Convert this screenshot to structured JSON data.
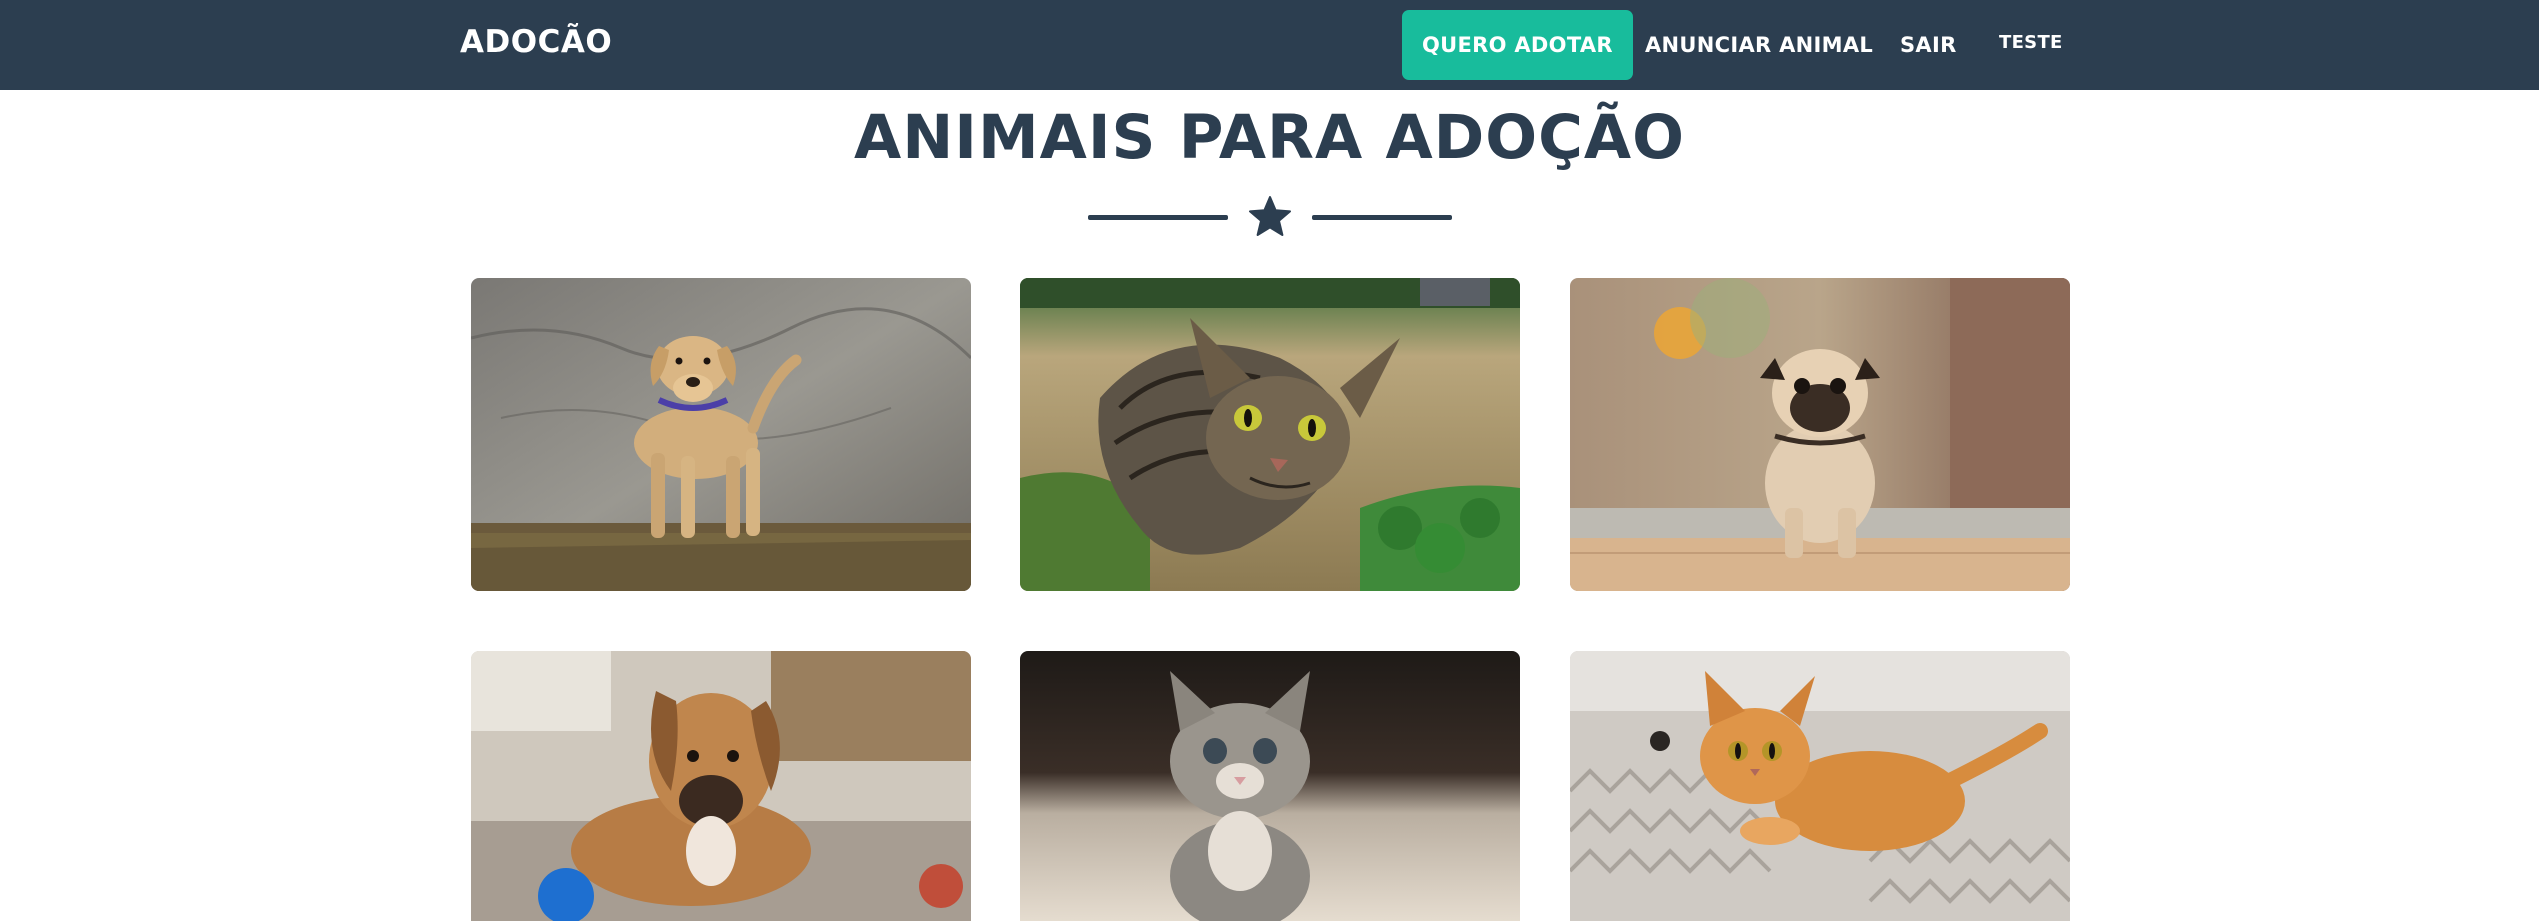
{
  "navbar": {
    "brand": "ADOCÃO",
    "items": [
      {
        "label": "QUERO ADOTAR",
        "active": true
      },
      {
        "label": "ANUNCIAR ANIMAL",
        "active": false
      },
      {
        "label": "SAIR",
        "active": false
      },
      {
        "label": "TESTE",
        "active": false
      }
    ]
  },
  "main": {
    "title": "ANIMAIS PARA ADOÇÃO",
    "divider_icon": "star-icon"
  },
  "gallery": {
    "items": [
      {
        "animal": "dog",
        "subject": "labrador"
      },
      {
        "animal": "cat",
        "subject": "tabby cat"
      },
      {
        "animal": "dog",
        "subject": "pug"
      },
      {
        "animal": "dog",
        "subject": "puppy"
      },
      {
        "animal": "cat",
        "subject": "gray kitten"
      },
      {
        "animal": "cat",
        "subject": "orange cat"
      }
    ]
  },
  "colors": {
    "navbar_bg": "#2c3e50",
    "active_button": "#18bc9c",
    "heading": "#2c3e50",
    "page_bg": "#ffffff"
  }
}
